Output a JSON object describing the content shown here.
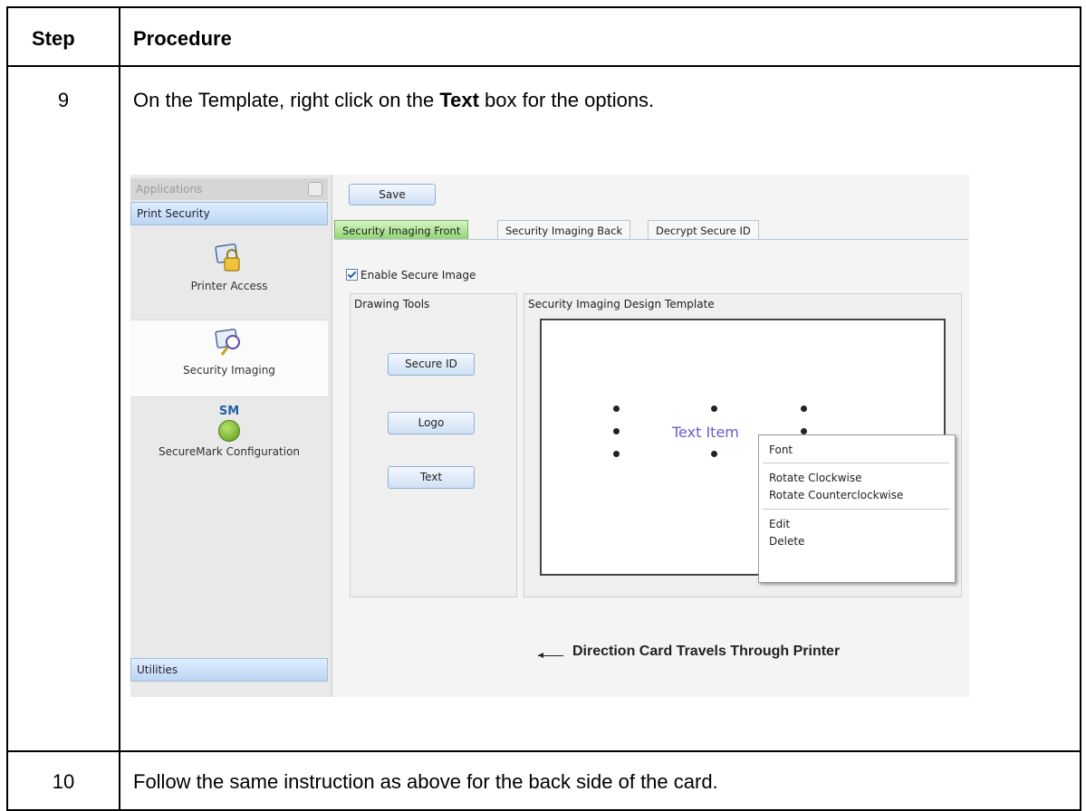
{
  "table": {
    "headers": {
      "step": "Step",
      "procedure": "Procedure"
    },
    "rows": [
      {
        "step": "9",
        "text_before": "On the Template, right click on the ",
        "bold": "Text",
        "text_after": " box for the options."
      },
      {
        "step": "10",
        "text": "Follow the same instruction as above for the back side of the card."
      }
    ]
  },
  "screenshot": {
    "sidebar": {
      "title": "Applications",
      "section": "Print Security",
      "items": [
        {
          "label": "Printer Access",
          "icon": "printer-access-lock-icon"
        },
        {
          "label": "Security Imaging",
          "icon": "security-imaging-icon"
        },
        {
          "label": "SecureMark Configuration",
          "icon": "securemark-ball-icon",
          "badge": "SM"
        }
      ],
      "footer": "Utilities"
    },
    "toolbar": {
      "save": "Save"
    },
    "tabs": [
      "Security Imaging Front",
      "Security Imaging Back",
      "Decrypt Secure ID"
    ],
    "enable_secure_image": "Enable Secure Image",
    "drawing_tools": {
      "title": "Drawing Tools",
      "buttons": [
        "Secure ID",
        "Logo",
        "Text"
      ]
    },
    "template": {
      "title": "Security Imaging Design Template",
      "text_item": "Text Item"
    },
    "context_menu": [
      "Font",
      "Rotate Clockwise",
      "Rotate Counterclockwise",
      "Edit",
      "Delete"
    ],
    "direction": "Direction Card Travels Through Printer"
  },
  "colors": {
    "active_tab": "#8fd46f",
    "accent_blue": "#bcd6f2",
    "text_item": "#6a5acd"
  }
}
